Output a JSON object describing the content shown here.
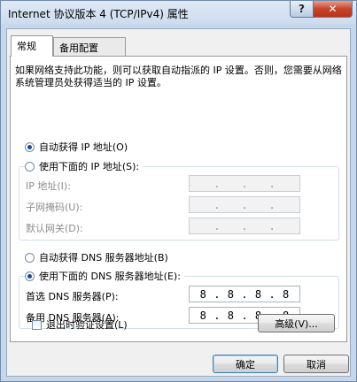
{
  "window": {
    "title": "Internet 协议版本 4 (TCP/IPv4) 属性",
    "help_label": "?",
    "close_label": "✕"
  },
  "tabs": [
    {
      "label": "常规",
      "active": true
    },
    {
      "label": "备用配置",
      "active": false
    }
  ],
  "description": "如果网络支持此功能，则可以获取自动指派的 IP 设置。否则，您需要从网络系统管理员处获得适当的 IP 设置。",
  "ip_settings": {
    "auto_label": "自动获得 IP 地址(O)",
    "auto_checked": true,
    "manual_label": "使用下面的 IP 地址(S):",
    "manual_checked": false,
    "fields": [
      {
        "label": "IP 地址(I):",
        "value": [
          "",
          "",
          "",
          ""
        ],
        "enabled": false
      },
      {
        "label": "子网掩码(U):",
        "value": [
          "",
          "",
          "",
          ""
        ],
        "enabled": false
      },
      {
        "label": "默认网关(D):",
        "value": [
          "",
          "",
          "",
          ""
        ],
        "enabled": false
      }
    ]
  },
  "dns_settings": {
    "auto_label": "自动获得 DNS 服务器地址(B)",
    "auto_checked": false,
    "manual_label": "使用下面的 DNS 服务器地址(E):",
    "manual_checked": true,
    "fields": [
      {
        "label": "首选 DNS 服务器(P):",
        "value": [
          "8",
          "8",
          "8",
          "8"
        ],
        "enabled": true
      },
      {
        "label": "备用 DNS 服务器(A):",
        "value": [
          "8",
          "8",
          "8",
          "8"
        ],
        "enabled": true
      }
    ]
  },
  "validate_on_exit": {
    "label": "退出时验证设置(L)",
    "checked": false
  },
  "buttons": {
    "advanced": "高级(V)...",
    "ok": "确定",
    "cancel": "取消"
  }
}
